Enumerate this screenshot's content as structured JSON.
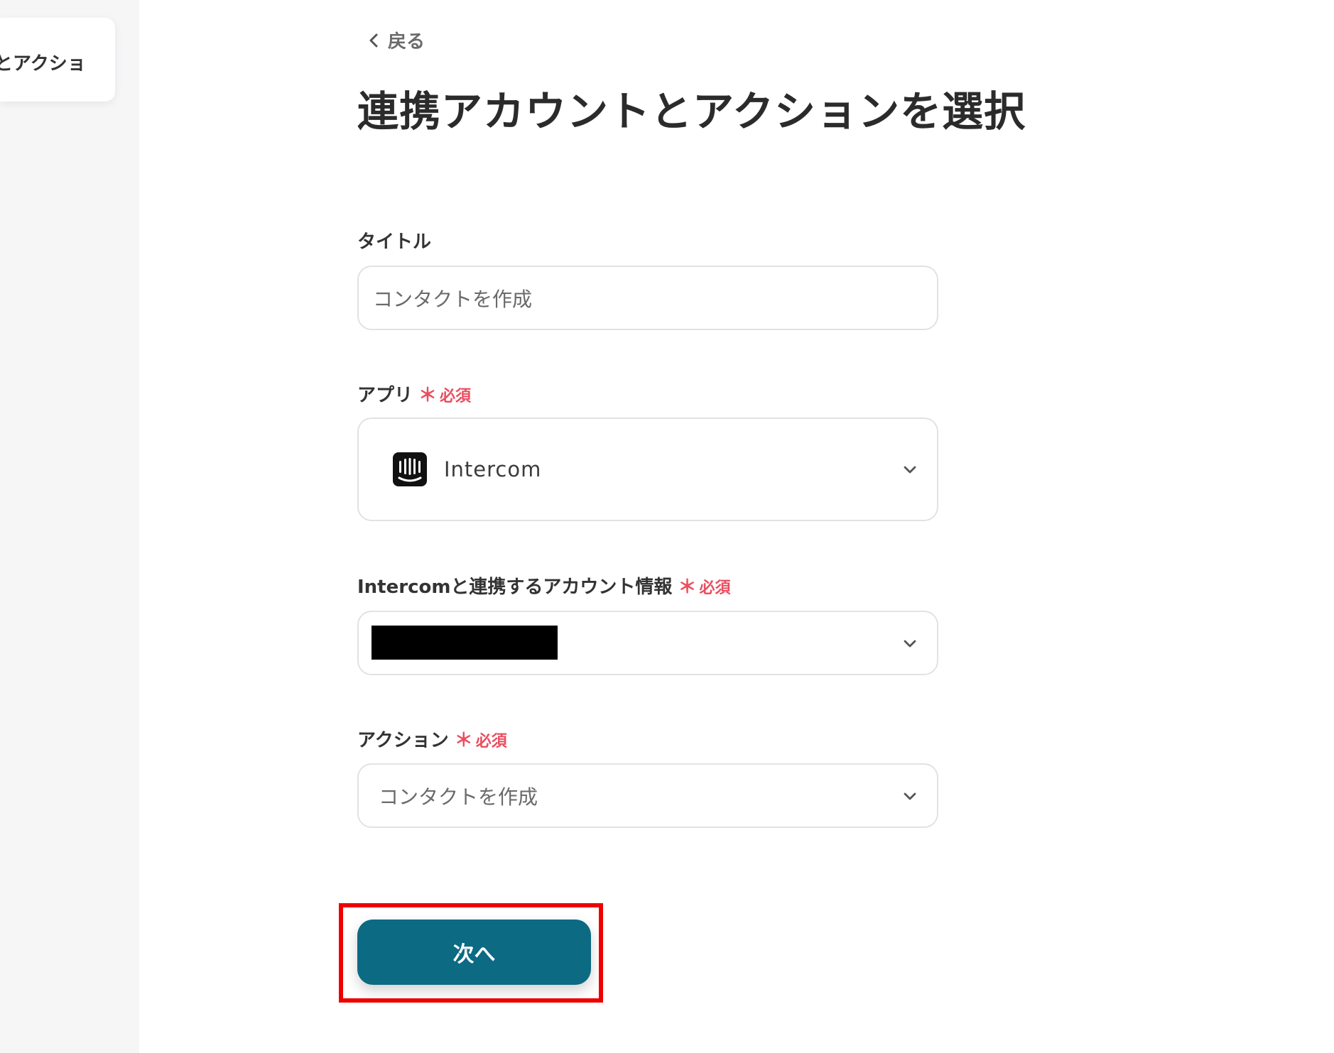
{
  "sidebar": {
    "card_label": "とアクショ"
  },
  "header": {
    "back_label": "戻る",
    "title": "連携アカウントとアクションを選択"
  },
  "form": {
    "title_field": {
      "label": "タイトル",
      "value": "コンタクトを作成"
    },
    "app_field": {
      "label": "アプリ",
      "required_star": "＊",
      "required_text": "必須",
      "value": "Intercom",
      "icon": "intercom-logo-icon"
    },
    "account_field": {
      "label": "Intercomと連携するアカウント情報",
      "required_star": "＊",
      "required_text": "必須"
    },
    "action_field": {
      "label": "アクション",
      "required_star": "＊",
      "required_text": "必須",
      "value": "コンタクトを作成"
    },
    "next_button_label": "次へ"
  },
  "colors": {
    "primary_button": "#0c6a83",
    "required": "#ea4d5f",
    "highlight_border": "#ee0000",
    "sidebar_bg": "#f6f6f7"
  }
}
